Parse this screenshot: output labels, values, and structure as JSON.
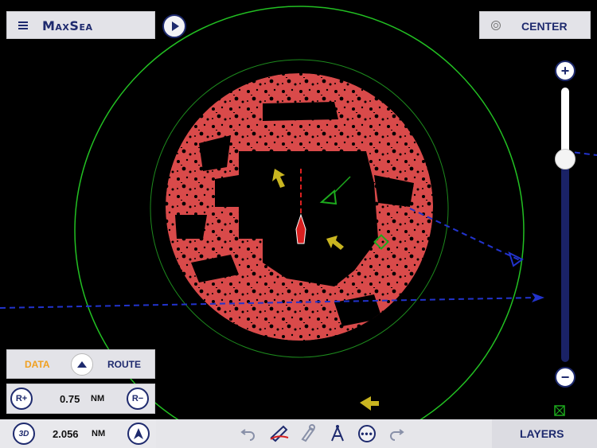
{
  "app": {
    "logo": "MaxSea",
    "menu_icon": "hamburger-icon",
    "play_icon": "play-icon"
  },
  "center_button": {
    "label": "CENTER",
    "icon": "target-icon"
  },
  "zoom": {
    "plus_label": "+",
    "minus_label": "−",
    "level": 0.74
  },
  "data_route": {
    "data_label": "DATA",
    "route_label": "ROUTE",
    "toggle_icon": "triangle-up-icon"
  },
  "range": {
    "plus_label": "R+",
    "minus_label": "R−",
    "value": "0.75",
    "unit": "NM"
  },
  "bottom_left": {
    "mode_label": "3D",
    "value": "2.056",
    "unit": "NM",
    "compass_icon": "north-arrow-icon"
  },
  "toolbar": {
    "icons": [
      "undo-icon",
      "boat-route-icon",
      "tools-icon",
      "compass-draw-icon",
      "more-icon",
      "redo-icon"
    ]
  },
  "layers_button": {
    "label": "LAYERS"
  },
  "colors": {
    "radar_echo": "#d94a4a",
    "range_ring": "#22c022",
    "route_line": "#2233cc",
    "data_accent": "#f0a020",
    "navy": "#1e2a6e"
  }
}
